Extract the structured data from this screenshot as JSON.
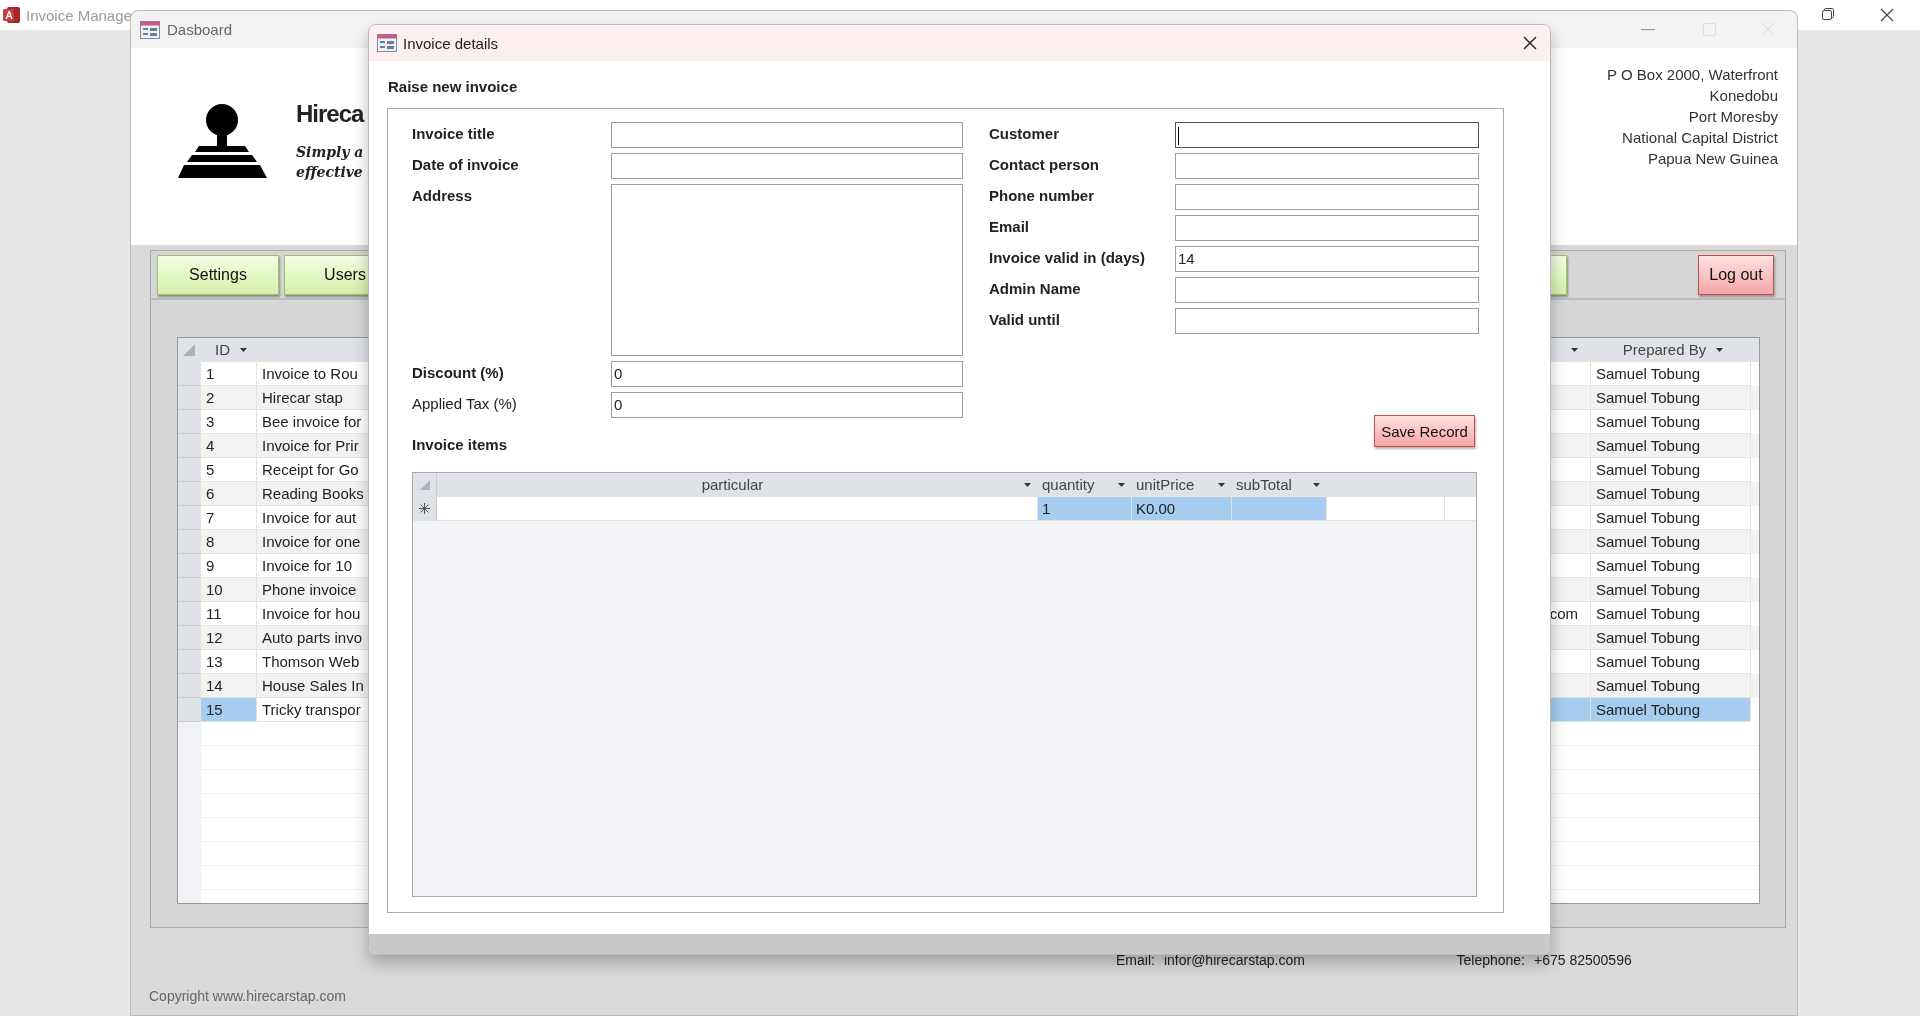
{
  "app": {
    "title": "Invoice Manage"
  },
  "dashboard": {
    "title": "Dasboard",
    "company": "Hireca",
    "tagline": [
      "Simply a",
      "effective"
    ],
    "address": [
      "P O Box 2000, Waterfront",
      "Konedobu",
      "Port Moresby",
      "National Capital District",
      "Papua New Guinea"
    ],
    "toolbar": [
      {
        "label": "Settings"
      },
      {
        "label": "Users"
      }
    ],
    "logout": "Log out",
    "table": {
      "columns": [
        {
          "label": "ID"
        },
        {
          "label": "Prepared By"
        }
      ],
      "rows": [
        {
          "id": "1",
          "title": "Invoice to Rou",
          "prepared_by": "Samuel Tobung",
          "selected": false
        },
        {
          "id": "2",
          "title": "Hirecar stap",
          "prepared_by": "Samuel Tobung",
          "selected": false
        },
        {
          "id": "3",
          "title": "Bee invoice for",
          "prepared_by": "Samuel Tobung",
          "selected": false
        },
        {
          "id": "4",
          "title": "Invoice for Prir",
          "prepared_by": "Samuel Tobung",
          "selected": false
        },
        {
          "id": "5",
          "title": "Receipt for Go",
          "prepared_by": "Samuel Tobung",
          "selected": false
        },
        {
          "id": "6",
          "title": "Reading Books",
          "prepared_by": "Samuel Tobung",
          "selected": false
        },
        {
          "id": "7",
          "title": "Invoice for aut",
          "prepared_by": "Samuel Tobung",
          "selected": false
        },
        {
          "id": "8",
          "title": "Invoice for one",
          "prepared_by": "Samuel Tobung",
          "selected": false
        },
        {
          "id": "9",
          "title": "Invoice for 10",
          "prepared_by": "Samuel Tobung",
          "selected": false
        },
        {
          "id": "10",
          "title": "Phone invoice",
          "prepared_by": "Samuel Tobung",
          "selected": false
        },
        {
          "id": "11",
          "title": "Invoice for hou",
          "column_4": "com",
          "prepared_by": "Samuel Tobung",
          "selected": false
        },
        {
          "id": "12",
          "title": "Auto parts invo",
          "prepared_by": "Samuel Tobung",
          "selected": false
        },
        {
          "id": "13",
          "title": "Thomson Web",
          "prepared_by": "Samuel Tobung",
          "selected": false
        },
        {
          "id": "14",
          "title": "House Sales In",
          "prepared_by": "Samuel Tobung",
          "selected": false
        },
        {
          "id": "15",
          "title": "Tricky transpor",
          "prepared_by": "Samuel Tobung",
          "selected": true
        }
      ]
    },
    "footer": {
      "email_label": "Email:",
      "email": "infor@hirecarstap.com",
      "phone_label": "Telephone:",
      "phone": "+675 82500596",
      "copyright": "Copyright www.hirecarstap.com"
    }
  },
  "dialog": {
    "title": "Invoice details",
    "heading": "Raise new invoice",
    "left_fields": [
      {
        "label": "Invoice title",
        "kind": "text",
        "bold": true
      },
      {
        "label": "Date of invoice",
        "kind": "text",
        "bold": true
      },
      {
        "label": "Address",
        "kind": "textarea",
        "bold": true
      },
      {
        "label": "Discount (%)",
        "kind": "text",
        "bold": true,
        "value": "0"
      },
      {
        "label": "Applied Tax (%)",
        "kind": "text",
        "bold": false,
        "value": "0"
      }
    ],
    "right_fields": [
      {
        "label": "Customer",
        "focused": true
      },
      {
        "label": "Contact person",
        "focused": false
      },
      {
        "label": "Phone number",
        "focused": false
      },
      {
        "label": "Email",
        "focused": false
      },
      {
        "label": "Invoice valid in (days)",
        "value": "14",
        "focused": false
      },
      {
        "label": "Admin Name",
        "focused": false
      },
      {
        "label": "Valid until",
        "focused": false
      }
    ],
    "save": "Save Record",
    "items_label": "Invoice items",
    "items": {
      "columns": [
        "particular",
        "quantity",
        "unitPrice",
        "subTotal"
      ],
      "rows": [
        {
          "new": true,
          "selected": true,
          "quantity": "1",
          "unit_price": "K0.00"
        }
      ]
    }
  }
}
